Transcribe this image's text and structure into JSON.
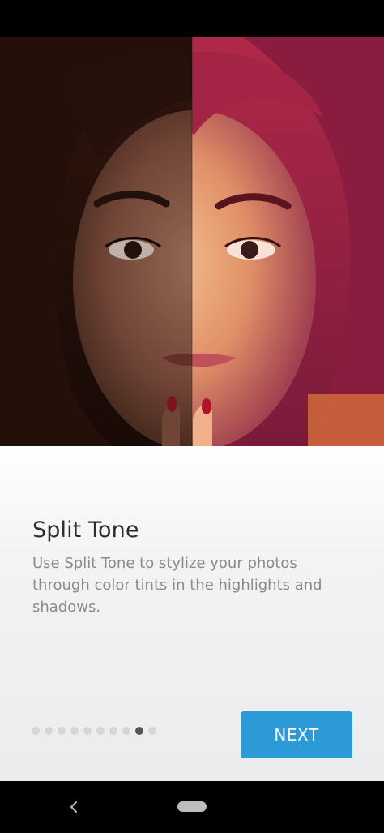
{
  "onboarding": {
    "title": "Split Tone",
    "description": "Use Split Tone to stylize your photos through color tints in the highlights and shadows.",
    "next_label": "NEXT",
    "page_indicator": {
      "total": 10,
      "current": 9
    }
  },
  "navigation": {
    "back_icon": "back-chevron-icon",
    "home_icon": "home-pill-icon"
  },
  "colors": {
    "accent": "#2b9ad7",
    "title_text": "#2c2c2c",
    "body_text": "#8a8a8a"
  }
}
